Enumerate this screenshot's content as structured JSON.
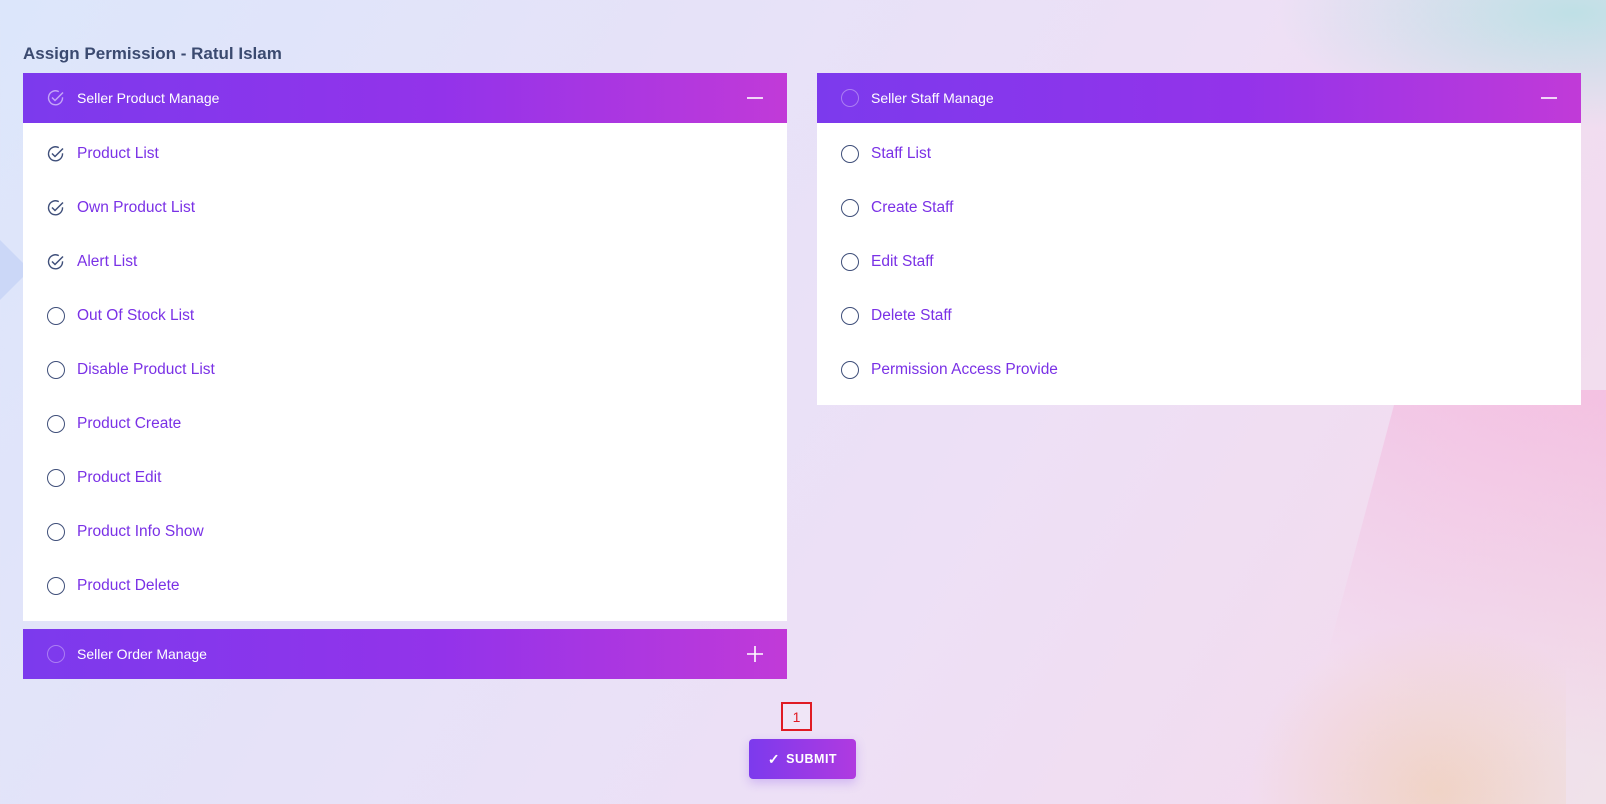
{
  "page": {
    "title": "Assign Permission - Ratul Islam"
  },
  "colors": {
    "accent_start": "#7c3aed",
    "accent_end": "#c13ad8",
    "label": "#7a31e6",
    "badge": "#e01b24"
  },
  "sections": {
    "product": {
      "label": "Seller Product Manage",
      "checked": true,
      "expanded": true,
      "toggle_icon": "minus-icon",
      "items": [
        {
          "label": "Product List",
          "checked": true
        },
        {
          "label": "Own Product List",
          "checked": true
        },
        {
          "label": "Alert List",
          "checked": true
        },
        {
          "label": "Out Of Stock List",
          "checked": false
        },
        {
          "label": "Disable Product List",
          "checked": false
        },
        {
          "label": "Product Create",
          "checked": false
        },
        {
          "label": "Product Edit",
          "checked": false
        },
        {
          "label": "Product Info Show",
          "checked": false
        },
        {
          "label": "Product Delete",
          "checked": false
        }
      ]
    },
    "staff": {
      "label": "Seller Staff Manage",
      "checked": false,
      "expanded": true,
      "toggle_icon": "minus-icon",
      "items": [
        {
          "label": "Staff List",
          "checked": false
        },
        {
          "label": "Create Staff",
          "checked": false
        },
        {
          "label": "Edit Staff",
          "checked": false
        },
        {
          "label": "Delete Staff",
          "checked": false
        },
        {
          "label": "Permission Access Provide",
          "checked": false
        }
      ]
    },
    "order": {
      "label": "Seller Order Manage",
      "checked": false,
      "expanded": false,
      "toggle_icon": "plus-icon"
    }
  },
  "badge": {
    "text": "1"
  },
  "submit": {
    "label": "SUBMIT",
    "icon": "✓"
  }
}
